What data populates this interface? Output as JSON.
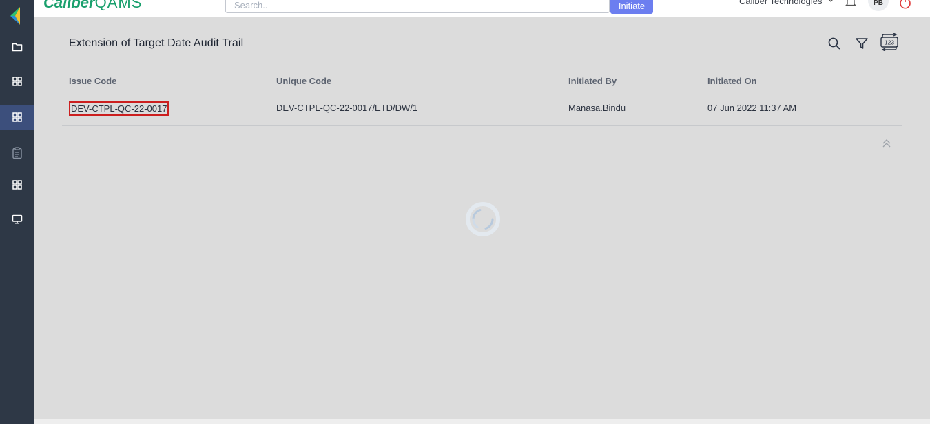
{
  "app": {
    "brand_part1": "Caliber",
    "brand_part2": "QAMS",
    "search_placeholder": "Search..",
    "initiate_label": "Initiate",
    "organization": "Caliber Technologies",
    "user_initials": "PB"
  },
  "sidebar": {
    "items": [
      {
        "icon": "folder-icon"
      },
      {
        "icon": "grid-icon"
      },
      {
        "icon": "grid-icon",
        "active": true
      },
      {
        "icon": "clipboard-icon"
      },
      {
        "icon": "grid-icon"
      },
      {
        "icon": "monitor-icon"
      }
    ]
  },
  "page": {
    "title": "Extension of Target Date Audit Trail",
    "tools": [
      "search-icon",
      "filter-icon",
      "counter-toggle-icon"
    ],
    "counter_badge": "123"
  },
  "table": {
    "columns": [
      "Issue Code",
      "Unique Code",
      "Initiated By",
      "Initiated On"
    ],
    "rows": [
      [
        "DEV-CTPL-QC-22-0017",
        "DEV-CTPL-QC-22-0017/ETD/DW/1",
        "Manasa.Bindu",
        "07 Jun 2022 11:37 AM"
      ]
    ]
  },
  "colors": {
    "sidebar_bg": "#2e3846",
    "sidebar_active": "#3c4f7c",
    "brand_green": "#1aa06d",
    "initiate_blue": "#6c7ef0",
    "highlight_red": "#cc1f1f",
    "content_bg": "#dcdcdc"
  }
}
